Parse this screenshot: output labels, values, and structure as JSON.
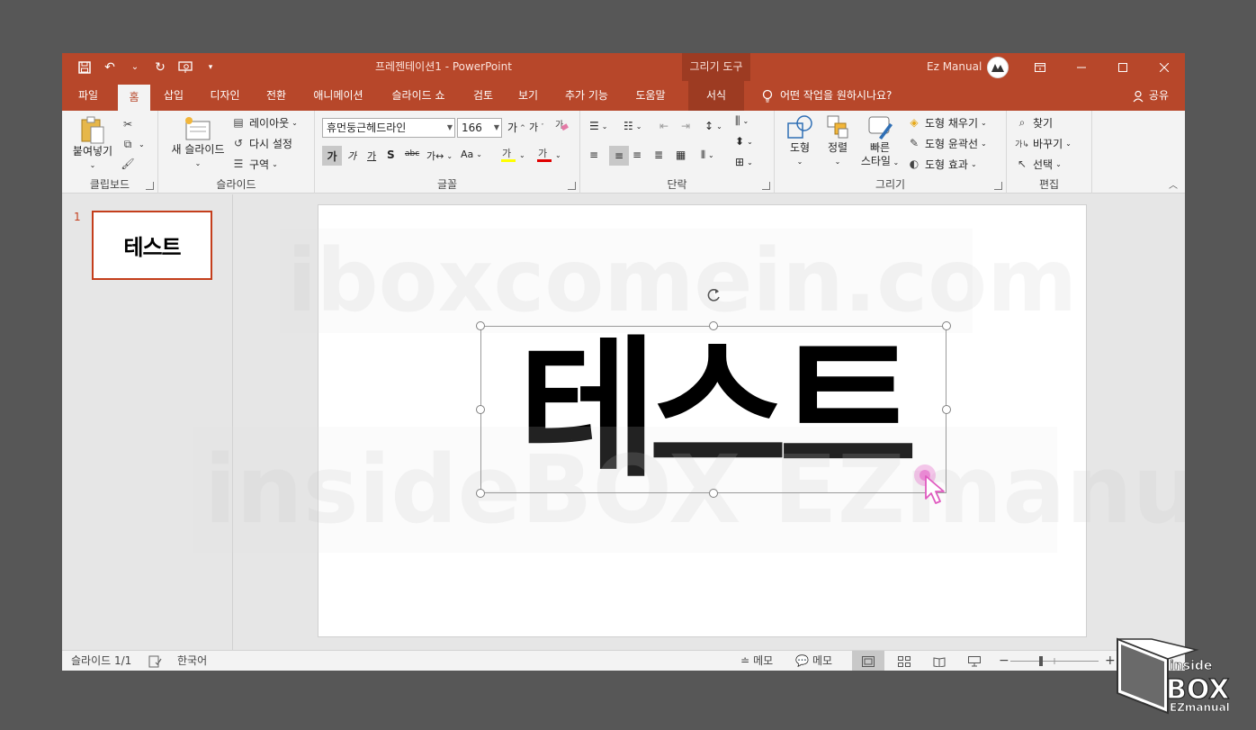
{
  "app": {
    "doc_title": "프레젠테이션1  -  PowerPoint",
    "context_tool": "그리기 도구",
    "account_name": "Ez Manual"
  },
  "tabs": [
    {
      "label": "파일"
    },
    {
      "label": "홈"
    },
    {
      "label": "삽입"
    },
    {
      "label": "디자인"
    },
    {
      "label": "전환"
    },
    {
      "label": "애니메이션"
    },
    {
      "label": "슬라이드 쇼"
    },
    {
      "label": "검토"
    },
    {
      "label": "보기"
    },
    {
      "label": "추가 기능"
    },
    {
      "label": "도움말"
    },
    {
      "label": "서식"
    }
  ],
  "tellme": "어떤 작업을 원하시나요?",
  "share": "공유",
  "ribbon": {
    "clipboard": {
      "label": "클립보드",
      "paste": "붙여넣기"
    },
    "slides": {
      "label": "슬라이드",
      "new_slide": "새 슬라이드",
      "layout": "레이아웃",
      "reset": "다시 설정",
      "section": "구역"
    },
    "font": {
      "label": "글꼴",
      "font_name": "휴먼둥근헤드라인",
      "font_size": "166"
    },
    "paragraph": {
      "label": "단락"
    },
    "drawing": {
      "label": "그리기",
      "shapes": "도형",
      "arrange": "정렬",
      "quick_styles_1": "빠른",
      "quick_styles_2": "스타일",
      "fill": "도형 채우기",
      "outline": "도형 윤곽선",
      "effects": "도형 효과"
    },
    "editing": {
      "label": "편집",
      "find": "찾기",
      "replace": "바꾸기",
      "select": "선택"
    }
  },
  "thumbnail": {
    "number": "1",
    "text": "테스트"
  },
  "slide": {
    "title_text": "테스트"
  },
  "watermarks": {
    "top": "iboxcomein.com",
    "bottom": "insideBOX EZmanual"
  },
  "status": {
    "slide_info": "슬라이드 1/1",
    "language": "한국어",
    "notes": "메모",
    "comments": "메모"
  },
  "logo": {
    "line1": "inside",
    "line2": "BOX",
    "line3": "EZmanual"
  },
  "colors": {
    "accent": "#b7472a",
    "accent_dark": "#9d3b22",
    "selected_thumb": "#c43e1c"
  }
}
